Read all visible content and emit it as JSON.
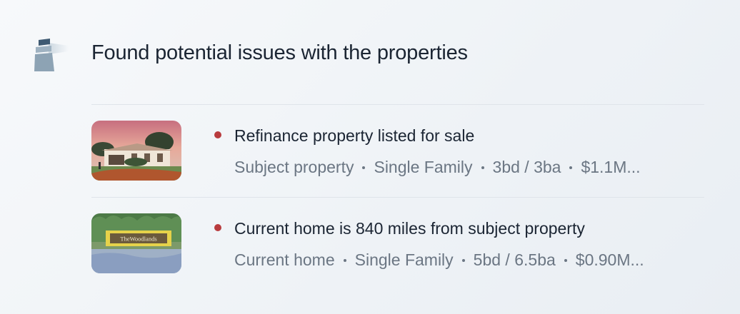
{
  "header": {
    "title": "Found potential issues with the properties"
  },
  "issues": [
    {
      "text": "Refinance property listed for sale",
      "meta": [
        "Subject property",
        "Single Family",
        "3bd / 3ba",
        "$1.1M..."
      ],
      "status_color": "#b83b3e"
    },
    {
      "text": "Current home is 840 miles from subject property",
      "meta": [
        "Current home",
        "Single Family",
        "5bd / 6.5ba",
        "$0.90M..."
      ],
      "sign_text": "TheWoodlands",
      "status_color": "#b83b3e"
    }
  ],
  "icons": {
    "logo": "lighthouse-logo-icon",
    "issue_dot": "alert-dot-icon"
  }
}
